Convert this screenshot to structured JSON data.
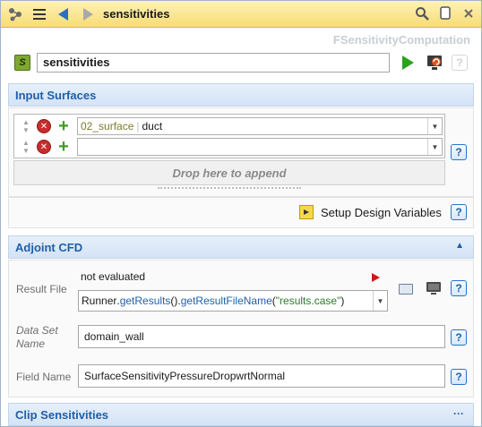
{
  "titlebar": {
    "title": "sensitivities",
    "icons": [
      "node-graph-icon",
      "menu-icon",
      "back-arrow-icon",
      "forward-arrow-icon",
      "search-icon",
      "copy-icon",
      "close-icon"
    ]
  },
  "header": {
    "class_name": "FSensitivityComputation",
    "node_icon_letter": "S",
    "name_value": "sensitivities",
    "help_label": "?"
  },
  "input_surfaces": {
    "title": "Input Surfaces",
    "rows": [
      {
        "prefix": "02_surface",
        "value": "duct"
      },
      {
        "prefix": "",
        "value": ""
      }
    ],
    "drop_text": "Drop here to append",
    "help_label": "?",
    "design_variables_label": "Setup Design Variables",
    "design_help_label": "?"
  },
  "adjoint_cfd": {
    "title": "Adjoint CFD",
    "result_file": {
      "label": "Result File",
      "status": "not evaluated",
      "expression_object": "Runner",
      "expression_method1": "getResults",
      "expression_method2": "getResultFileName",
      "expression_arg": "\"results.case\"",
      "help_label": "?"
    },
    "data_set_name": {
      "label": "Data Set Name",
      "value": "domain_wall",
      "help_label": "?"
    },
    "field_name": {
      "label": "Field Name",
      "value": "SurfaceSensitivityPressureDropwrtNormal",
      "help_label": "?"
    }
  },
  "clip_sensitivities": {
    "title": "Clip Sensitivities",
    "toggle": "···"
  },
  "colors": {
    "titlebar": "#f7dc74",
    "section_text": "#1f5fa8",
    "section_bg": "#d3e3f6",
    "run_green": "#2aa31c",
    "flag_red": "#d01818"
  }
}
